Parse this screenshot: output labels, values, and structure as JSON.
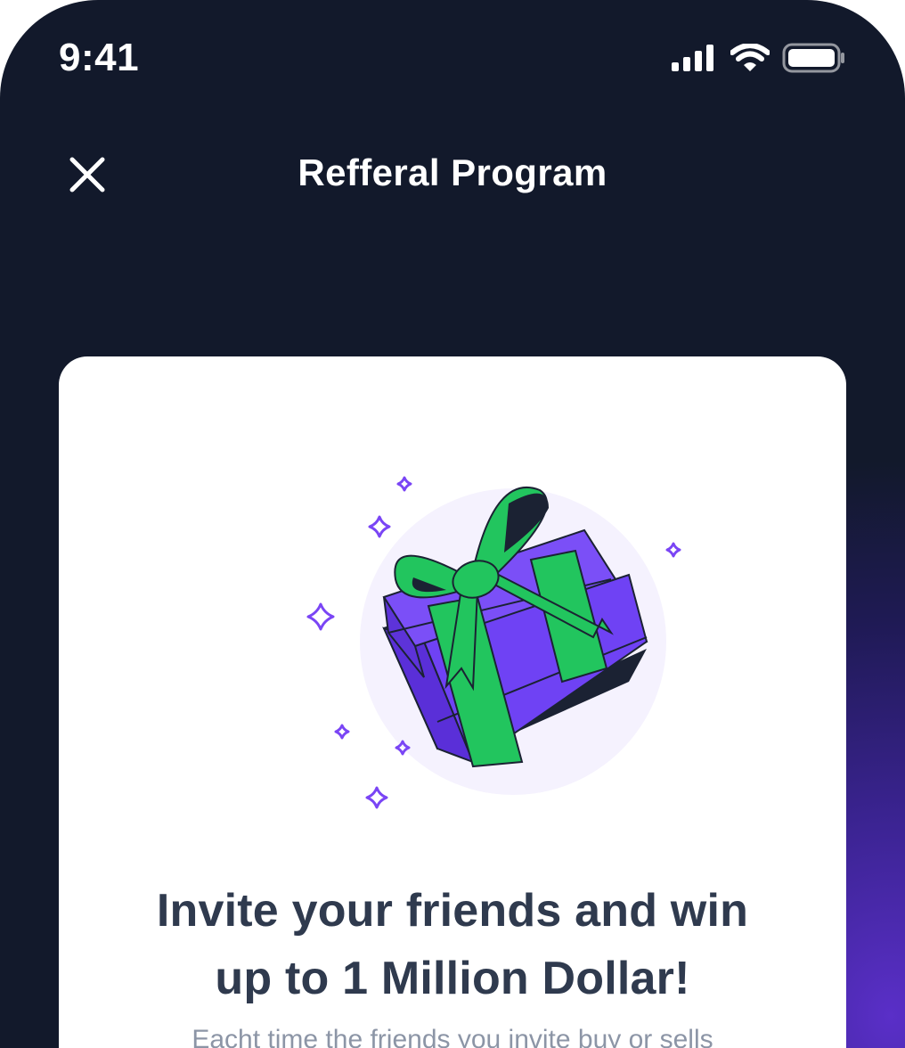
{
  "status_bar": {
    "time": "9:41",
    "icons": [
      "cellular-signal-icon",
      "wifi-icon",
      "battery-icon"
    ]
  },
  "header": {
    "close_icon": "close-icon",
    "title": "Refferal Program"
  },
  "card": {
    "illustration": "gift-box-illustration",
    "title_line1": "Invite your friends and win",
    "title_line2": "up to 1 Million Dollar!",
    "description": "Eacht time the friends you invite buy or sells"
  },
  "colors": {
    "background": "#12192b",
    "accent_purple": "#6a3cf0",
    "ribbon_green": "#22c55e",
    "title_text": "#2f3a4e",
    "body_text": "#8c95a6"
  }
}
